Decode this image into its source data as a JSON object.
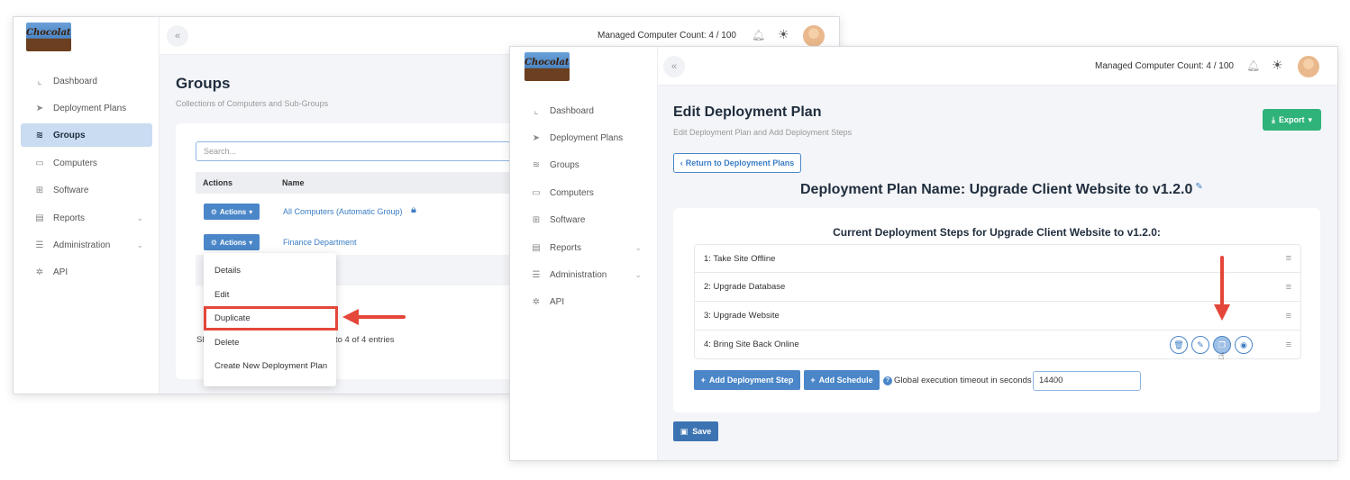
{
  "colors": {
    "accent": "#4a86c8",
    "arrow": "#e5463a",
    "export": "#2fb37a",
    "active_nav": "#c9dcf1"
  },
  "logo_text": "Chocolatey",
  "nav": [
    {
      "label": "Dashboard",
      "icon": "chart-icon"
    },
    {
      "label": "Deployment Plans",
      "icon": "paper-plane-icon"
    },
    {
      "label": "Groups",
      "icon": "layers-icon"
    },
    {
      "label": "Computers",
      "icon": "monitor-icon"
    },
    {
      "label": "Software",
      "icon": "grid-icon"
    },
    {
      "label": "Reports",
      "icon": "document-icon"
    },
    {
      "label": "Administration",
      "icon": "sliders-icon"
    },
    {
      "label": "API",
      "icon": "gear-icon"
    }
  ],
  "managed_count": "Managed Computer Count: 4 / 100",
  "groups_window": {
    "title": "Groups",
    "subtitle": "Collections of Computers and Sub-Groups",
    "search_placeholder": "Search...",
    "col_actions": "Actions",
    "col_name": "Name",
    "actions_label": "Actions",
    "rows": [
      "All Computers (Automatic Group)",
      "Finance Department"
    ],
    "dropdown": [
      "Details",
      "Edit",
      "Duplicate",
      "Delete",
      "Create New Deployment Plan"
    ],
    "entries_prefix": "Sh",
    "entries_suffix": "to 4 of 4 entries"
  },
  "plan_window": {
    "title": "Edit Deployment Plan",
    "subtitle": "Edit Deployment Plan and Add Deployment Steps",
    "export_label": "Export",
    "return_label": "Return to Deployment Plans",
    "plan_name": "Deployment Plan Name: Upgrade Client Website to v1.2.0",
    "steps_title": "Current Deployment Steps for Upgrade Client Website to v1.2.0:",
    "steps": [
      "1: Take Site Offline",
      "2: Upgrade Database",
      "3: Upgrade Website",
      "4: Bring Site Back Online"
    ],
    "add_step_label": "Add Deployment Step",
    "add_schedule_label": "Add Schedule",
    "timeout_label": "Global execution timeout in seconds",
    "timeout_value": "14400",
    "save_label": "Save"
  }
}
